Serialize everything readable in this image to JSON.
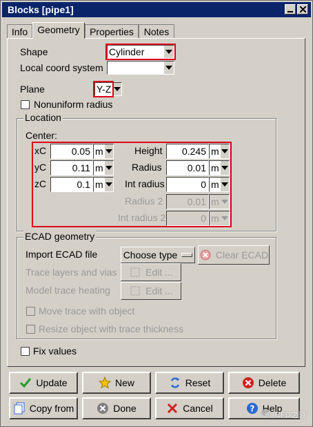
{
  "window": {
    "title": "Blocks [pipe1]"
  },
  "tabs": [
    {
      "label": "Info"
    },
    {
      "label": "Geometry"
    },
    {
      "label": "Properties"
    },
    {
      "label": "Notes"
    }
  ],
  "geometry": {
    "shape_label": "Shape",
    "shape_value": "Cylinder",
    "local_coord_label": "Local coord system",
    "local_coord_value": "",
    "plane_label": "Plane",
    "plane_value": "Y-Z",
    "nonuniform_radius_label": "Nonuniform radius"
  },
  "location": {
    "group_title": "Location",
    "center_label": "Center:",
    "xc_label": "xC",
    "xc_value": "0.05",
    "xc_unit": "m",
    "yc_label": "yC",
    "yc_value": "0.11",
    "yc_unit": "m",
    "zc_label": "zC",
    "zc_value": "0.1",
    "zc_unit": "m",
    "height_label": "Height",
    "height_value": "0.245",
    "height_unit": "m",
    "radius_label": "Radius",
    "radius_value": "0.01",
    "radius_unit": "m",
    "int_radius_label": "Int radius",
    "int_radius_value": "0",
    "int_radius_unit": "m",
    "radius2_label": "Radius 2",
    "radius2_value": "0.01",
    "radius2_unit": "m",
    "int_radius2_label": "Int radius 2",
    "int_radius2_value": "0",
    "int_radius2_unit": "m"
  },
  "ecad": {
    "group_title": "ECAD geometry",
    "import_label": "Import ECAD file",
    "choose_type_label": "Choose type",
    "clear_ecad_label": "Clear ECAD",
    "trace_layers_label": "Trace layers and vias",
    "edit_label_1": "Edit ...",
    "model_trace_label": "Model trace heating",
    "edit_label_2": "Edit ...",
    "move_trace_label": "Move trace with object",
    "resize_object_label": "Resize object with trace thickness"
  },
  "fix_values_label": "Fix values",
  "buttons": {
    "update": "Update",
    "new": "New",
    "reset": "Reset",
    "delete": "Delete",
    "copy_from": "Copy from",
    "done": "Done",
    "cancel": "Cancel",
    "help": "Help"
  },
  "watermark": "CFD之道",
  "colors": {
    "title_bar": "#0a246a",
    "highlight": "#e0001a",
    "face": "#d4d0c8"
  }
}
